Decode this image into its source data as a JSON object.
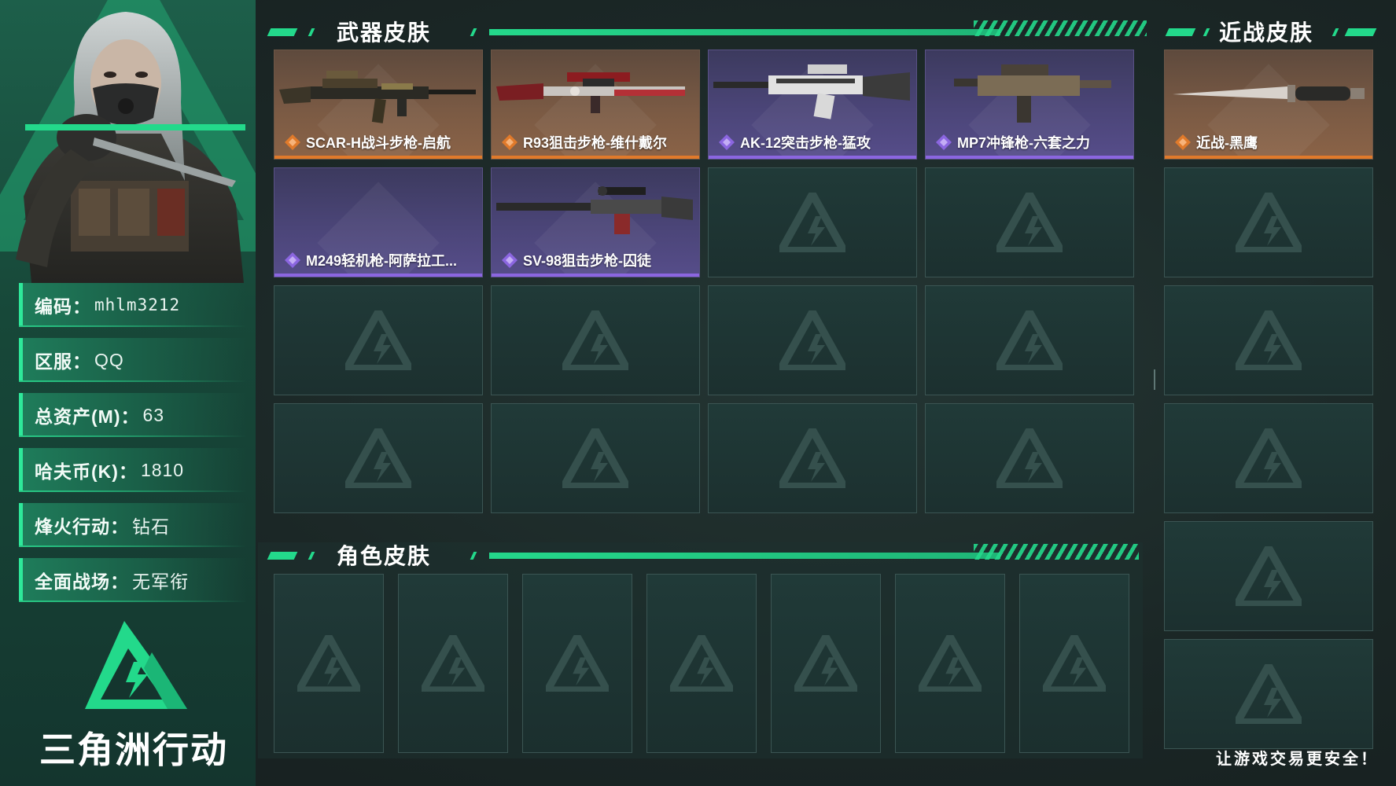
{
  "profile": {
    "fields": [
      {
        "label": "编码：",
        "value": "mhlm3212",
        "mono": true
      },
      {
        "label": "区服：",
        "value": "QQ",
        "mono": false
      },
      {
        "label": "总资产(M)：",
        "value": "63",
        "mono": false
      },
      {
        "label": "哈夫币(K)：",
        "value": "1810",
        "mono": false
      },
      {
        "label": "烽火行动：",
        "value": "钻石",
        "mono": false
      },
      {
        "label": "全面战场：",
        "value": "无军衔",
        "mono": false
      }
    ]
  },
  "logo": {
    "text": "三角洲行动"
  },
  "weapon_section": {
    "title": "武器皮肤",
    "items": [
      {
        "name": "SCAR-H战斗步枪-启航",
        "rarity": "orange"
      },
      {
        "name": "R93狙击步枪-维什戴尔",
        "rarity": "orange"
      },
      {
        "name": "AK-12突击步枪-猛攻",
        "rarity": "purple"
      },
      {
        "name": "MP7冲锋枪-六套之力",
        "rarity": "purple"
      },
      {
        "name": "M249轻机枪-阿萨拉工...",
        "rarity": "purple"
      },
      {
        "name": "SV-98狙击步枪-囚徒",
        "rarity": "purple"
      }
    ],
    "empty_slots": 10
  },
  "melee_section": {
    "title": "近战皮肤",
    "items": [
      {
        "name": "近战-黑鹰",
        "rarity": "orange"
      }
    ],
    "empty_slots": 5
  },
  "character_section": {
    "title": "角色皮肤",
    "empty_slots": 7
  },
  "footer": {
    "slogan": "让游戏交易更安全！"
  },
  "colors": {
    "accent_green": "#23d98b",
    "orange_rarity": "#e07a2b",
    "purple_rarity": "#8b66e0",
    "background": "#1c2a28"
  }
}
